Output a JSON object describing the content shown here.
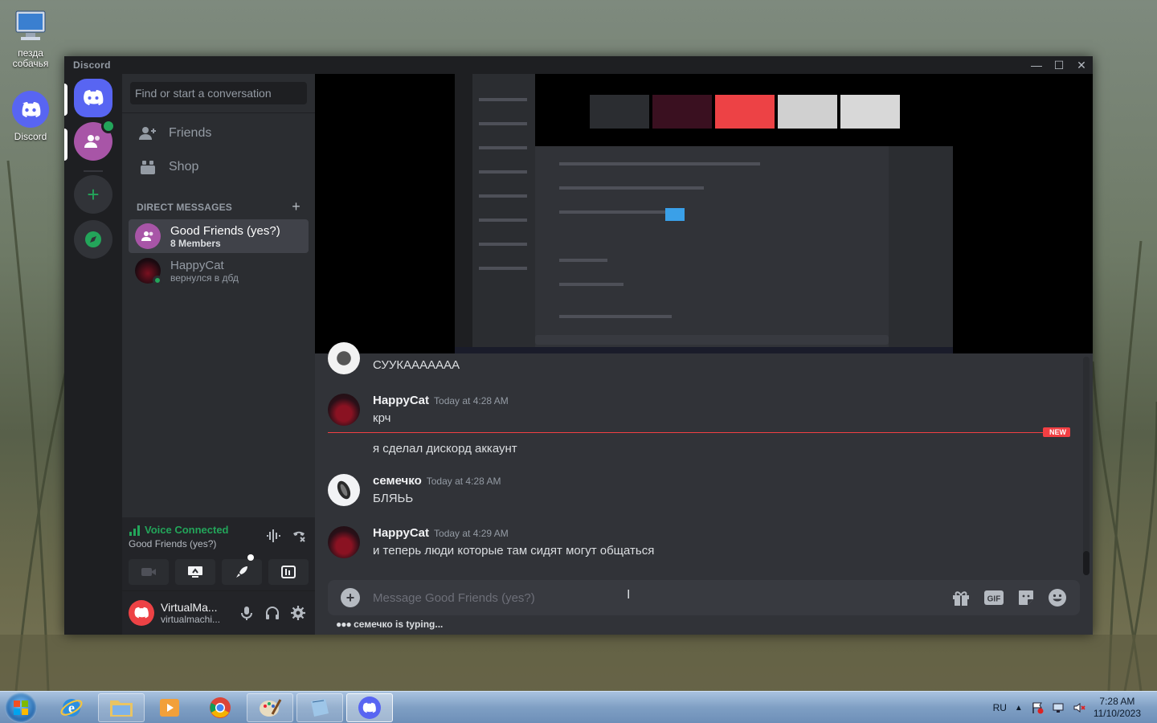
{
  "desktop": {
    "icons": [
      {
        "label": "пезда собачья",
        "icon": "computer-icon"
      },
      {
        "label": "Discord",
        "icon": "discord-icon"
      }
    ]
  },
  "window": {
    "title": "Discord",
    "controls": {
      "minimize": "—",
      "maximize": "☐",
      "close": "✕"
    }
  },
  "sidebar": {
    "search_placeholder": "Find or start a conversation",
    "nav": [
      {
        "label": "Friends",
        "icon": "friends-icon"
      },
      {
        "label": "Shop",
        "icon": "shop-icon"
      }
    ],
    "dm_header": "DIRECT MESSAGES",
    "dm_add": "+",
    "dms": [
      {
        "name": "Good Friends (yes?)",
        "sub": "8 Members",
        "active": true
      },
      {
        "name": "HappyCat",
        "sub": "вернулся в дбд",
        "active": false
      }
    ],
    "voice": {
      "status": "Voice Connected",
      "channel": "Good Friends (yes?)"
    },
    "user": {
      "name": "VirtualMa...",
      "tag": "virtualmachi..."
    }
  },
  "chat": {
    "messages": [
      {
        "author": "",
        "time": "",
        "lines": [
          "СУУКААААААА"
        ]
      },
      {
        "author": "HappyCat",
        "time": "Today at 4:28 AM",
        "lines": [
          "крч"
        ]
      },
      {
        "author": "",
        "time": "",
        "lines": [
          "я сделал дискорд аккаунт"
        ]
      },
      {
        "author": "семечко",
        "time": "Today at 4:28 AM",
        "lines": [
          "БЛЯЬЬ"
        ]
      },
      {
        "author": "HappyCat",
        "time": "Today at 4:29 AM",
        "lines": [
          "и теперь люди которые там сидят могут общаться"
        ]
      }
    ],
    "new_badge": "NEW",
    "composer_placeholder": "Message Good Friends (yes?)",
    "typing_user": "семечко",
    "typing_suffix": " is typing..."
  },
  "taskbar": {
    "language": "RU",
    "time": "7:28 AM",
    "date": "11/10/2023",
    "apps": [
      "start-icon",
      "internet-explorer-icon",
      "file-explorer-icon",
      "media-player-icon",
      "chrome-icon",
      "paint-icon",
      "notebook-icon",
      "discord-icon"
    ]
  },
  "colors": {
    "blurple": "#5865f2",
    "green": "#23a55a",
    "red": "#f23f43"
  }
}
